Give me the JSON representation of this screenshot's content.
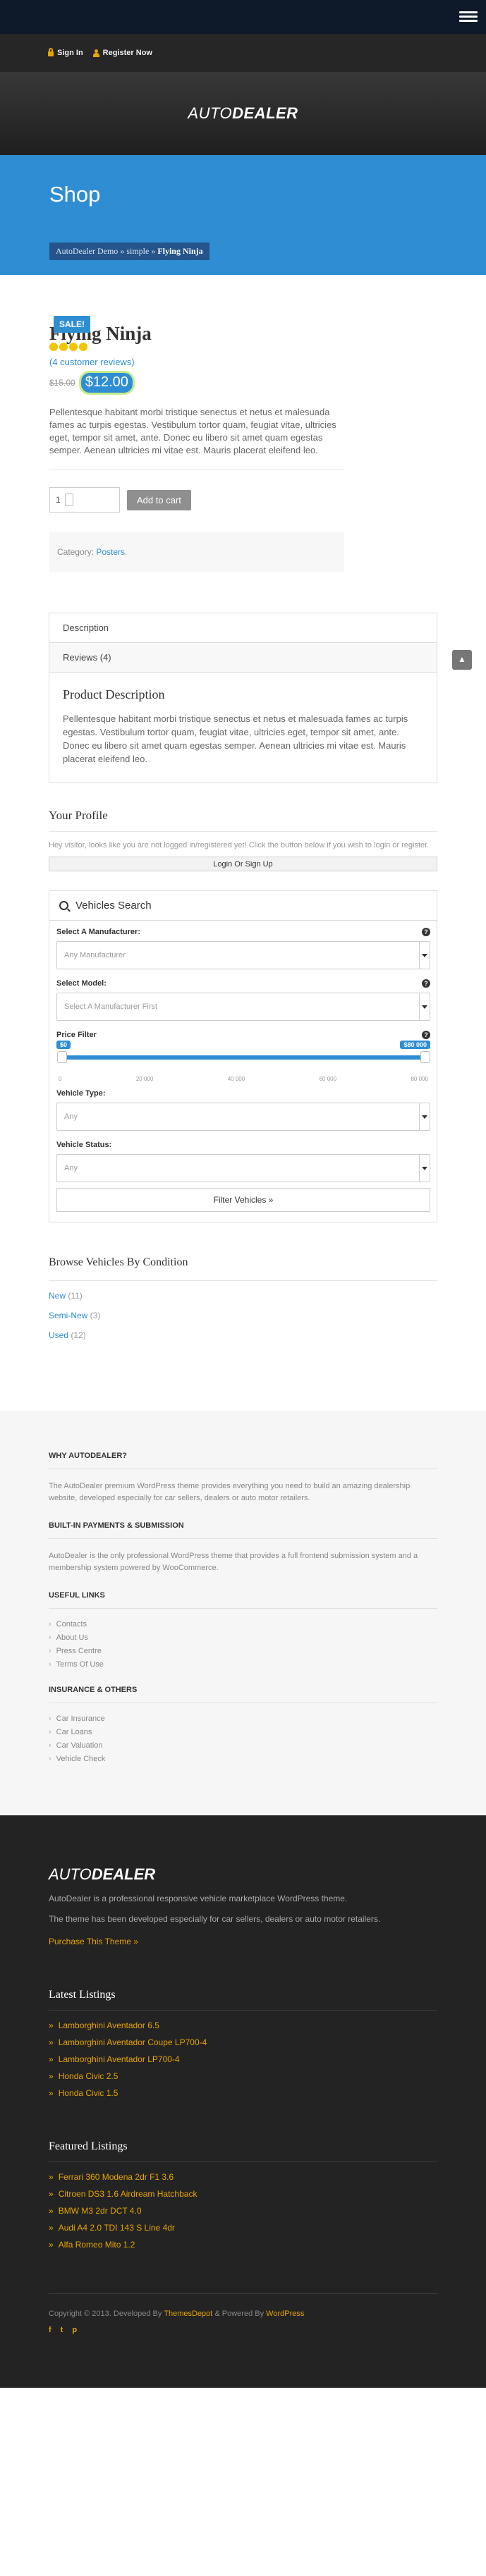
{
  "auth": {
    "sign_in": "Sign In",
    "register": "Register Now"
  },
  "logo": {
    "part1": "AUTO",
    "part2": "DEALER"
  },
  "banner": {
    "title": "Shop",
    "crumb_home": "AutoDealer Demo",
    "crumb_sep1": " » ",
    "crumb_cat": "simple",
    "crumb_sep2": " » ",
    "crumb_current": "Flying Ninja"
  },
  "product": {
    "sale": "SALE!",
    "title": "Flying Ninja",
    "reviews": "(4 customer reviews)",
    "old_price": "$15.00",
    "new_price": "$12.00",
    "description": "Pellentesque habitant morbi tristique senectus et netus et malesuada fames ac turpis egestas. Vestibulum tortor quam, feugiat vitae, ultricies eget, tempor sit amet, ante. Donec eu libero sit amet quam egestas semper. Aenean ultricies mi vitae est. Mauris placerat eleifend leo.",
    "qty": "1",
    "add_to_cart": "Add to cart",
    "category_label": "Category: ",
    "category": "Posters",
    "category_end": "."
  },
  "tabs": {
    "description": "Description",
    "reviews": "Reviews (4)",
    "panel_title": "Product Description",
    "panel_text": "Pellentesque habitant morbi tristique senectus et netus et malesuada fames ac turpis egestas. Vestibulum tortor quam, feugiat vitae, ultricies eget, tempor sit amet, ante. Donec eu libero sit amet quam egestas semper. Aenean ultricies mi vitae est. Mauris placerat eleifend leo."
  },
  "profile": {
    "title": "Your Profile",
    "text": "Hey visitor, looks like you are not logged in/registered yet! Click the button below if you wish to login or register.",
    "button": "Login Or Sign Up"
  },
  "vehicle_search": {
    "title": "Vehicles Search",
    "manufacturer_label": "Select A Manufacturer:",
    "manufacturer_value": "Any Manufacturer",
    "model_label": "Select Model:",
    "model_value": "Select A Manufacturer First",
    "price_label": "Price Filter",
    "price_min": "$0",
    "price_max": "$80 000",
    "ticks": [
      "0",
      "20 000",
      "40 000",
      "60 000",
      "80 000"
    ],
    "type_label": "Vehicle Type:",
    "type_value": "Any",
    "status_label": "Vehicle Status:",
    "status_value": "Any",
    "button": "Filter Vehicles »"
  },
  "browse": {
    "title": "Browse Vehicles By Condition",
    "items": [
      {
        "label": "New",
        "count": " (11)"
      },
      {
        "label": "Semi-New",
        "count": " (3)"
      },
      {
        "label": "Used",
        "count": " (12)"
      }
    ]
  },
  "footer_light": {
    "why_title": "WHY AUTODEALER?",
    "why_text": "The AutoDealer premium WordPress theme provides everything you need to build an amazing dealership website, developed especially for car sellers, dealers or auto motor retailers.",
    "built_title": "BUILT-IN PAYMENTS & SUBMISSION",
    "built_text": "AutoDealer is the only professional WordPress theme that provides a full frontend submission system and a membership system powered by WooCommerce.",
    "useful_title": "USEFUL LINKS",
    "useful": [
      "Contacts",
      "About Us",
      "Press Centre",
      "Terms Of Use"
    ],
    "ins_title": "INSURANCE & OTHERS",
    "insurance": [
      "Car Insurance",
      "Car Loans",
      "Car Valuation",
      "Vehicle Check"
    ]
  },
  "footer_dark": {
    "logo1": "AUTO",
    "logo2": "DEALER",
    "about1": "AutoDealer is a professional responsive vehicle marketplace WordPress theme.",
    "about2": "The theme has been developed especially for car sellers, dealers or auto motor retailers.",
    "purchase": "Purchase This Theme »",
    "latest_title": "Latest Listings",
    "latest": [
      "Lamborghini Aventador 6.5",
      "Lamborghini Aventador Coupe LP700-4",
      "Lamborghini Aventador LP700-4",
      "Honda Civic 2.5",
      "Honda Civic 1.5"
    ],
    "featured_title": "Featured Listings",
    "featured": [
      "Ferrari 360 Modena 2dr F1 3.6",
      "Citroen DS3 1.6 Airdream Hatchback",
      "BMW M3 2dr DCT 4.0",
      "Audi A4 2.0 TDI 143 S Line 4dr",
      "Alfa Romeo Mito 1.2"
    ],
    "copy_pre": "Copyright © 2013. Developed By ",
    "copy_dev": "ThemesDepot",
    "copy_mid": " & Powered By ",
    "copy_wp": "WordPress",
    "social": [
      "f",
      "t",
      "p"
    ]
  }
}
